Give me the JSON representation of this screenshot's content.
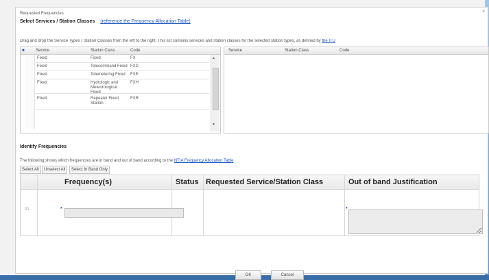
{
  "window": {
    "close_glyph": "×"
  },
  "header": {
    "subtitle": "Requested Frequencies",
    "title": "Select Services / Station Classes",
    "ref_link": "(reference the Frequency Allocation Table)"
  },
  "instructions": {
    "text": "Drag and drop the Service Types / Station Classes from the left to the right. This list contains services and station classes for the selected station types, as defined by ",
    "link": "the ITU"
  },
  "available": {
    "columns": [
      "Service",
      "Station Class",
      "Code"
    ],
    "rows": [
      {
        "service": "Fixed",
        "station_class": "Fixed",
        "code": "FX"
      },
      {
        "service": "Fixed",
        "station_class": "Telecommand Fixed",
        "code": "FXD"
      },
      {
        "service": "Fixed",
        "station_class": "Telemetering Fixed",
        "code": "FXE"
      },
      {
        "service": "Fixed",
        "station_class": "Hydrologic and Meteorological Fixed",
        "code": "FXH"
      },
      {
        "service": "Fixed",
        "station_class": "Repeater Fixed Station",
        "code": "FXR"
      }
    ]
  },
  "selected": {
    "columns": [
      "Service",
      "Station Class",
      "Code"
    ]
  },
  "identify": {
    "title": "Identify Frequencies",
    "note": "The following shows which frequencies are in band and out of band according to the ",
    "note_link": "NTIA Frequency Allocation Table",
    "buttons": [
      "Select All",
      "Unselect All",
      "Select In Band Only"
    ]
  },
  "freq_table": {
    "columns": [
      "Frequency(s)",
      "Status",
      "Requested Service/Station Class",
      "Out of band Justification"
    ],
    "row_number": "01",
    "required_marker": "*",
    "frequency_value": "",
    "status": "",
    "requested_service": "",
    "justification": ""
  },
  "footer": {
    "ok_label": "OK",
    "cancel_label": "Cancel"
  }
}
